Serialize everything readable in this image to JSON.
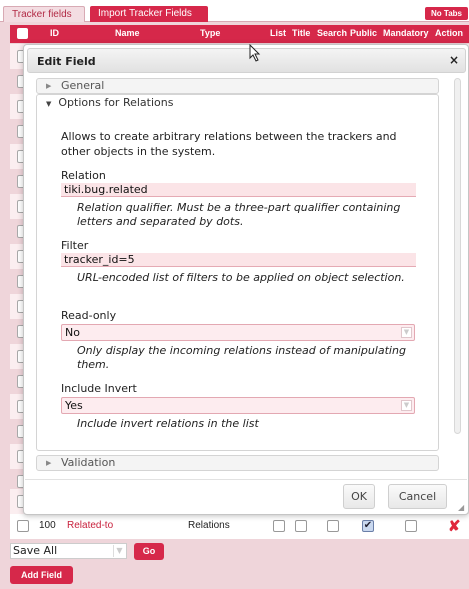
{
  "tabs": [
    "Tracker fields",
    "Import Tracker Fields",
    "No Tabs"
  ],
  "table_header": [
    "ID",
    "Name",
    "Type",
    "List",
    "Title",
    "Search",
    "Public",
    "Mandatory",
    "Action"
  ],
  "dialog": {
    "title": "Edit Field",
    "close_icon": "×",
    "sections": {
      "general": "General",
      "relations": "Options for Relations",
      "validation": "Validation"
    },
    "description": "Allows to create arbitrary relations between the trackers and other objects in the system.",
    "relation": {
      "label": "Relation",
      "value": "tiki.bug.related",
      "help": "Relation qualifier. Must be a three-part qualifier containing letters and separated by dots."
    },
    "filter": {
      "label": "Filter",
      "value": "tracker_id=5",
      "help": "URL-encoded list of filters to be applied on object selection."
    },
    "readonly": {
      "label": "Read-only",
      "value": "No",
      "help": "Only display the incoming relations instead of manipulating them."
    },
    "include_invert": {
      "label": "Include Invert",
      "value": "Yes",
      "help": "Include invert relations in the list"
    },
    "ok_label": "OK",
    "cancel_label": "Cancel"
  },
  "row": {
    "id": "100",
    "name": "Related-to",
    "type": "Relations",
    "search_checked": true
  },
  "bulk": {
    "select_value": "Save All",
    "go_label": "Go"
  },
  "add_field_label": "Add Field"
}
